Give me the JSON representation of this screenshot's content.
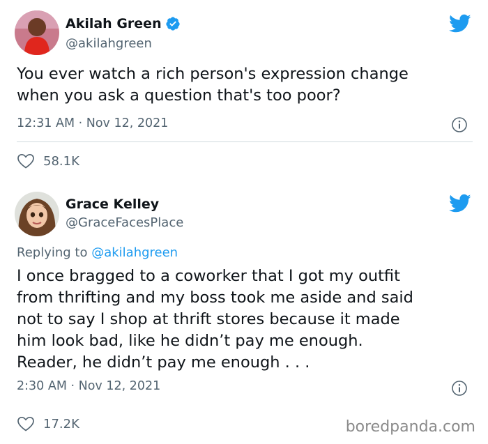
{
  "tweets": [
    {
      "display_name": "Akilah Green",
      "handle": "@akilahgreen",
      "verified": true,
      "text": "You ever watch a rich person's expression change\nwhen you ask a question that's too poor?",
      "timestamp": "12:31 AM · Nov 12, 2021",
      "likes": "58.1K"
    },
    {
      "display_name": "Grace Kelley",
      "handle": "@GraceFacesPlace",
      "verified": false,
      "replying_to_prefix": "Replying to ",
      "replying_to_handle": "@akilahgreen",
      "text": "I once bragged to a coworker that I got my outfit\nfrom thrifting and my boss took me aside and said\nnot to say I shop at thrift stores because it made\nhim look bad, like he didn’t pay me enough.\nReader, he didn’t pay me enough . . .",
      "timestamp": "2:30 AM · Nov 12, 2021",
      "likes": "17.2K"
    }
  ],
  "watermark": "boredpanda.com",
  "colors": {
    "twitter_blue": "#1d9bf0",
    "text_primary": "#0f1419",
    "text_secondary": "#536471",
    "divider": "#cfd9de"
  },
  "icons": [
    "verified-badge-icon",
    "twitter-bird-icon",
    "info-icon",
    "heart-icon"
  ]
}
